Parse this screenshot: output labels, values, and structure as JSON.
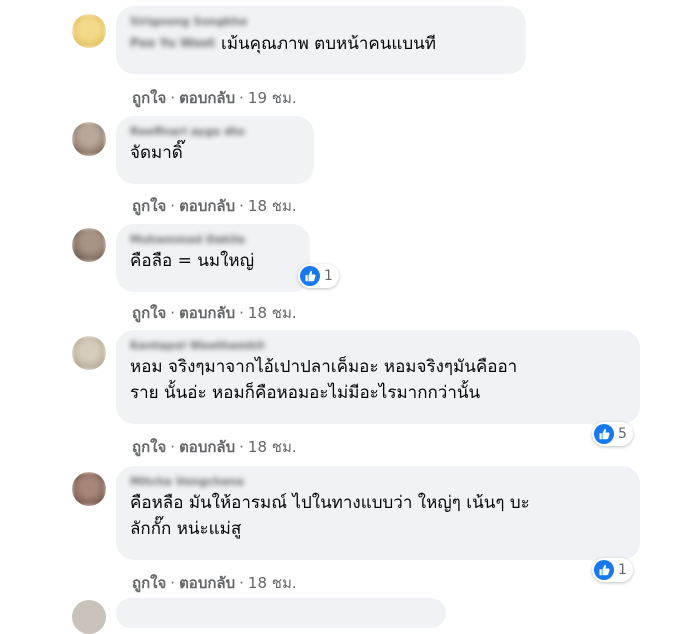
{
  "comments": [
    {
      "author": "Sirigoong Songkha",
      "inline_author": "Poo Yu Woot",
      "text": "เม้นคุณภาพ ตบหน้าคนแบนที",
      "like": "ถูกใจ",
      "reply": "ตอบกลับ",
      "time": "19 ชม.",
      "reaction_count": ""
    },
    {
      "author": "Reeffnarl ayga dto",
      "text": "จัดมาดิ๊",
      "like": "ถูกใจ",
      "reply": "ตอบกลับ",
      "time": "18 ชม.",
      "reaction_count": ""
    },
    {
      "author": "Muhammad Dakila",
      "text": "คือลือ = นมใหญ่",
      "like": "ถูกใจ",
      "reply": "ตอบกลับ",
      "time": "18 ชม.",
      "reaction_count": "1"
    },
    {
      "author": "Kantapol Weethamkit",
      "text": "หอม จริงๆมาจากไอ้เปาปลาเค็มอะ หอมจริงๆมันคืออา\nราย นั้นอ่ะ หอมก็คือหอมอะไม่มีอะไรมากกว่านั้น",
      "like": "ถูกใจ",
      "reply": "ตอบกลับ",
      "time": "18 ชม.",
      "reaction_count": "5"
    },
    {
      "author": "Mitcha Vongchana",
      "text": "คือหลือ มันให้อารมณ์ ไปในทางแบบว่า ใหญ่ๆ เน้นๆ บะ\nลักกั๊ก หน่ะแม่สู",
      "like": "ถูกใจ",
      "reply": "ตอบกลับ",
      "time": "18 ชม.",
      "reaction_count": "1"
    }
  ],
  "colors": {
    "bubble": "#f0f2f5",
    "like_blue": "#1877f2",
    "meta_gray": "#65676b"
  }
}
